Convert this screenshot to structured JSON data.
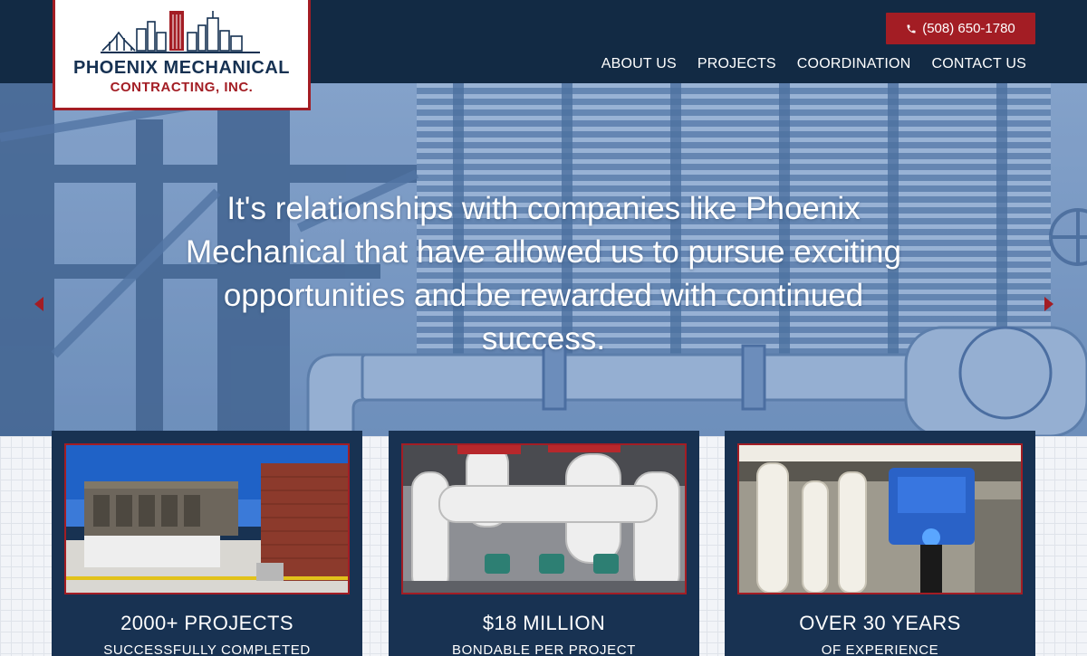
{
  "header": {
    "logo_name": "PHOENIX MECHANICAL",
    "logo_sub": "CONTRACTING, INC.",
    "phone": "(508) 650-1780",
    "nav": [
      "ABOUT US",
      "PROJECTS",
      "COORDINATION",
      "CONTACT US"
    ]
  },
  "hero": {
    "quote_part1": "It's relationships with companies like ",
    "quote_highlight": "Phoenix Mechanical",
    "quote_part2": " that have allowed us to pursue exciting opportunities and be rewarded with continued success."
  },
  "cards": [
    {
      "title": "2000+ PROJECTS",
      "subtitle": "SUCCESSFULLY COMPLETED"
    },
    {
      "title": "$18 MILLION",
      "subtitle": "BONDABLE PER PROJECT"
    },
    {
      "title": "OVER 30 YEARS",
      "subtitle": "OF EXPERIENCE"
    }
  ],
  "colors": {
    "navy": "#122a44",
    "accent_red": "#a31d24",
    "hero_blue": "#7f9dc4"
  },
  "icons": [
    "phone-icon",
    "chevron-left-icon",
    "chevron-right-icon"
  ]
}
